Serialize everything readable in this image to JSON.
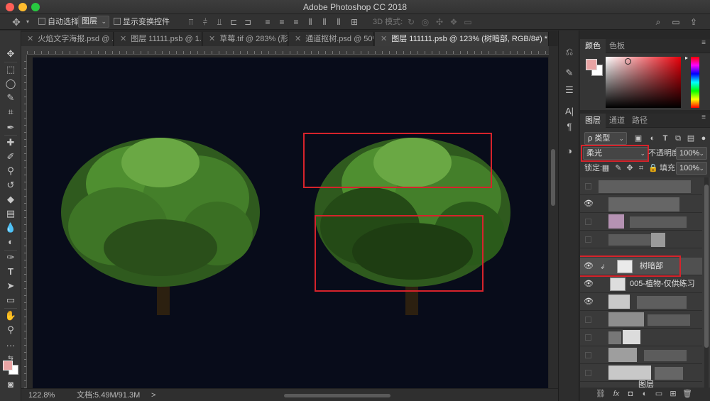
{
  "window": {
    "title": "Adobe Photoshop CC 2018"
  },
  "options_bar": {
    "auto_select_label": "自动选择:",
    "auto_select_value": "图层",
    "show_transform_label": "显示变换控件",
    "mode_3d_label": "3D 模式:"
  },
  "tabs": [
    {
      "label": "火焰文字海报.psd @ ...",
      "active": false
    },
    {
      "label": "图层 11111.psb @ 1...",
      "active": false
    },
    {
      "label": "草莓.tif @ 283% (形...",
      "active": false
    },
    {
      "label": "通道抠树.psd @ 50%...",
      "active": false
    },
    {
      "label": "图层 111111.psb @ 123% (树暗部, RGB/8#) *",
      "active": true
    }
  ],
  "status": {
    "zoom": "122.8%",
    "doc_info": "文档:5.49M/91.3M",
    "arrow": ">"
  },
  "color_panel": {
    "tabs": [
      "颜色",
      "色板"
    ],
    "fg_color": "#e8a3a3",
    "bg_color": "#ffffff"
  },
  "layers_panel": {
    "tabs": [
      "图层",
      "通道",
      "路径"
    ],
    "filter_label": "ρ 类型",
    "blend_mode": "柔光",
    "opacity_label": "不透明度:",
    "opacity_value": "100%",
    "lock_label": "锁定:",
    "fill_label": "填充:",
    "fill_value": "100%",
    "layers": [
      {
        "name": "",
        "visible": false
      },
      {
        "name": "",
        "visible": true
      },
      {
        "name": "",
        "visible": false
      },
      {
        "name": "",
        "visible": false
      },
      {
        "name": "树暗部",
        "visible": true,
        "selected": true
      },
      {
        "name": "005-植物-仅供练习",
        "visible": true
      },
      {
        "name": "",
        "visible": true
      },
      {
        "name": "",
        "visible": false
      },
      {
        "name": "",
        "visible": false
      },
      {
        "name": "",
        "visible": false
      },
      {
        "name": "",
        "visible": false
      },
      {
        "name": "图层",
        "visible": false
      }
    ]
  },
  "accent": {
    "annotation_red": "#d6232b"
  }
}
